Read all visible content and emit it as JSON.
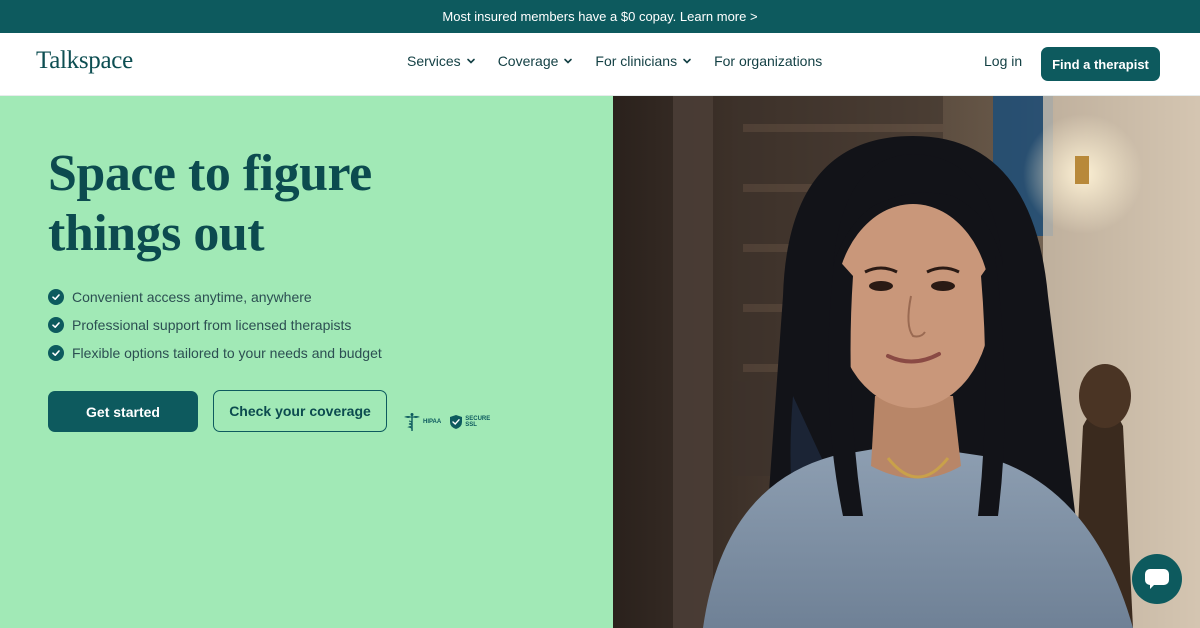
{
  "promo": {
    "text": "Most insured members have a $0 copay. Learn more >"
  },
  "nav": {
    "logo": "Talkspace",
    "items": [
      {
        "label": "Services",
        "has_dropdown": true
      },
      {
        "label": "Coverage",
        "has_dropdown": true
      },
      {
        "label": "For clinicians",
        "has_dropdown": true
      },
      {
        "label": "For organizations",
        "has_dropdown": false
      }
    ],
    "login": "Log in",
    "cta": "Find a therapist"
  },
  "hero": {
    "headline_line1": "Space to figure",
    "headline_line2": "things out",
    "bullets": [
      "Convenient access anytime, anywhere",
      "Professional support from licensed therapists",
      "Flexible options tailored to your needs and budget"
    ],
    "primary_cta": "Get started",
    "secondary_cta": "Check your coverage",
    "badges": {
      "hipaa": "HIPAA",
      "secure_line1": "SECURE",
      "secure_line2": "SSL"
    }
  },
  "chat": {
    "icon": "chat-bubble-icon"
  },
  "colors": {
    "brand": "#0d5a5e",
    "hero_bg": "#a1e9b6",
    "text_dark": "#0c4b4f"
  }
}
